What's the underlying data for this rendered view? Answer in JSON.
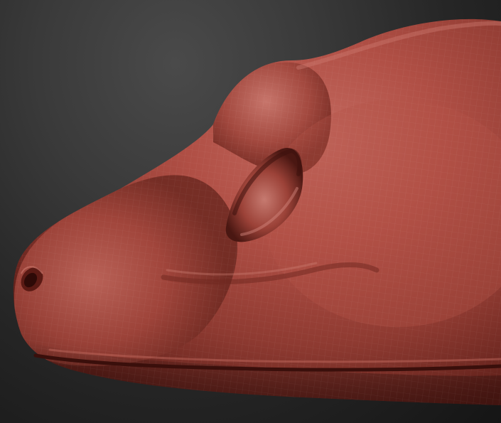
{
  "viewport": {
    "background_color": "#2e2e2e",
    "model_color": "#a8443a",
    "model_highlight": "#c46a60",
    "model_shadow": "#5e1f19"
  },
  "model": {
    "parts": [
      "head",
      "brow-ridge",
      "eye-socket",
      "nostril",
      "mouth-line",
      "wireframe-mesh"
    ]
  }
}
